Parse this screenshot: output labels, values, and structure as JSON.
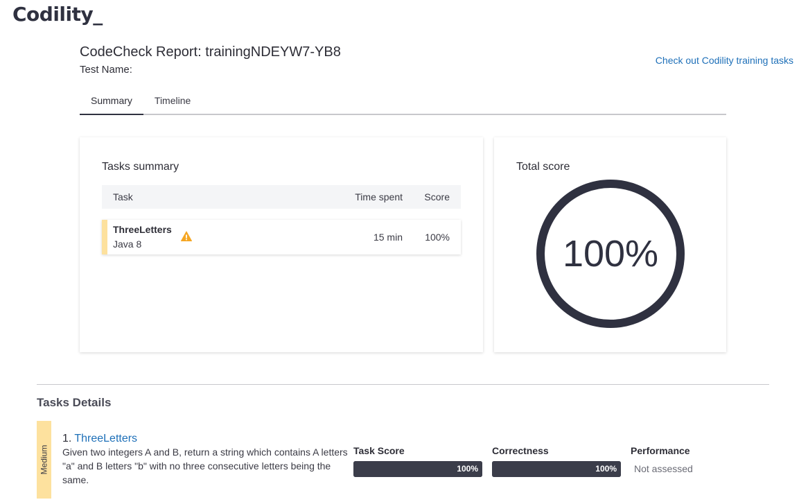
{
  "brand": {
    "name": "Codility",
    "cursor": "_"
  },
  "header": {
    "title": "CodeCheck Report: trainingNDEYW7-YB8",
    "test_name_label": "Test Name:",
    "training_link": "Check out Codility training tasks"
  },
  "tabs": [
    {
      "label": "Summary",
      "active": true
    },
    {
      "label": "Timeline",
      "active": false
    }
  ],
  "tasks_summary": {
    "title": "Tasks summary",
    "columns": [
      "Task",
      "Time spent",
      "Score"
    ],
    "rows": [
      {
        "name": "ThreeLetters",
        "language": "Java 8",
        "time_spent": "15 min",
        "score": "100%",
        "icon": "warning-icon"
      }
    ]
  },
  "total_score": {
    "title": "Total score",
    "value": "100%",
    "fraction": 1.0
  },
  "task_details": {
    "title": "Tasks Details",
    "items": [
      {
        "difficulty": "Medium",
        "number": "1.",
        "name": "ThreeLetters",
        "description": "Given two integers A and B, return a string which contains A letters \"a\" and B letters \"b\" with no three consecutive letters being the same.",
        "metrics": {
          "task_score_label": "Task Score",
          "task_score_value": "100%",
          "task_score_fraction": 1.0,
          "correctness_label": "Correctness",
          "correctness_value": "100%",
          "correctness_fraction": 1.0,
          "performance_label": "Performance",
          "performance_value": "Not assessed"
        }
      }
    ]
  },
  "colors": {
    "accent_dark": "#2f3140",
    "link": "#1d6fb8",
    "difficulty_medium": "#fde19e",
    "warning": "#f5a623"
  }
}
